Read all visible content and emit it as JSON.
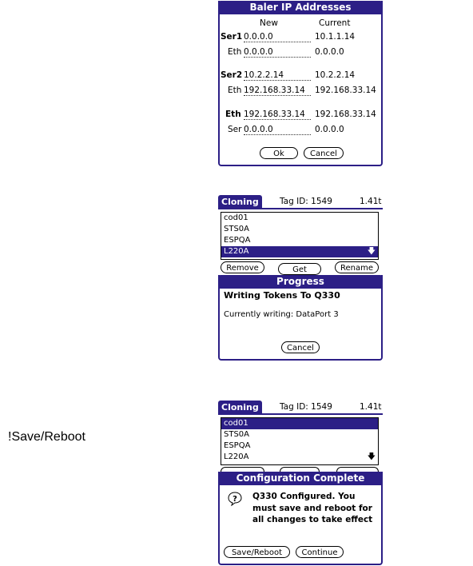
{
  "ip_dialog": {
    "title": "Baler IP Addresses",
    "col_new": "New",
    "col_current": "Current",
    "rows": [
      {
        "label": "Ser1",
        "new": "0.0.0.0",
        "current": "10.1.1.14"
      },
      {
        "label": "Eth",
        "new": "0.0.0.0",
        "current": "0.0.0.0"
      },
      {
        "label": "Ser2",
        "new": "10.2.2.14",
        "current": "10.2.2.14"
      },
      {
        "label": "Eth",
        "new": "192.168.33.14",
        "current": "192.168.33.14"
      },
      {
        "label": "Eth",
        "new": "192.168.33.14",
        "current": "192.168.33.14"
      },
      {
        "label": "Ser",
        "new": "0.0.0.0",
        "current": "0.0.0.0"
      }
    ],
    "ok_label": "Ok",
    "cancel_label": "Cancel"
  },
  "cloning1": {
    "header": {
      "tab": "Cloning",
      "tag_id": "Tag ID: 1549",
      "version": "1.41t"
    },
    "list": [
      "cod01",
      "STS0A",
      "ESPQA",
      "L220A"
    ],
    "selected_index": 3,
    "buttons": {
      "remove": "Remove",
      "get": "Get",
      "rename": "Rename"
    },
    "progress": {
      "title": "Progress",
      "heading": "Writing Tokens To Q330",
      "status": "Currently writing: DataPort 3",
      "cancel_label": "Cancel"
    }
  },
  "cloning2": {
    "header": {
      "tab": "Cloning",
      "tag_id": "Tag ID: 1549",
      "version": "1.41t"
    },
    "list": [
      "cod01",
      "STS0A",
      "ESPQA",
      "L220A"
    ],
    "selected_index": 0,
    "complete": {
      "title": "Configuration Complete",
      "message": "Q330 Configured. You must save and reboot for all changes to take effect",
      "save_label": "Save/Reboot",
      "continue_label": "Continue"
    }
  },
  "note": "!Save/Reboot",
  "colors": {
    "accent": "#2c1f86"
  }
}
